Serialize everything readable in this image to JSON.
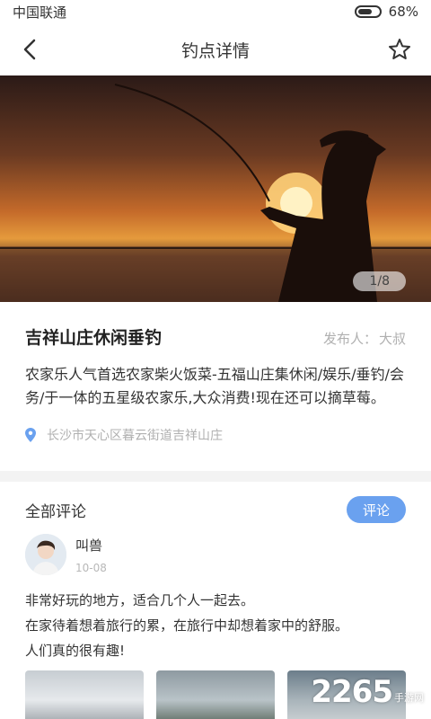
{
  "status_bar": {
    "carrier": "中国联通",
    "battery_text": "68%",
    "battery_level": 0.68
  },
  "nav": {
    "title": "钓点详情"
  },
  "hero": {
    "page_indicator": "1/8"
  },
  "spot": {
    "name": "吉祥山庄休闲垂钓",
    "publisher_label": "发布人：",
    "publisher_name": "大叔",
    "description": "农家乐人气首选农家柴火饭菜-五福山庄集休闲/娱乐/垂钓/会务/于一体的五星级农家乐,大众消费!现在还可以摘草莓。",
    "location": "长沙市天心区暮云街道吉祥山庄"
  },
  "comments": {
    "title": "全部评论",
    "button_label": "评论",
    "items": [
      {
        "username": "叫兽",
        "date": "10-08",
        "lines": [
          "非常好玩的地方，适合几个人一起去。",
          "在家待着想着旅行的累，在旅行中却想着家中的舒服。",
          "人们真的很有趣!"
        ]
      }
    ]
  },
  "watermark": {
    "number": "2265",
    "text": "手游网"
  },
  "colors": {
    "accent": "#6aa1ef",
    "divider": "#f3f3f3"
  }
}
